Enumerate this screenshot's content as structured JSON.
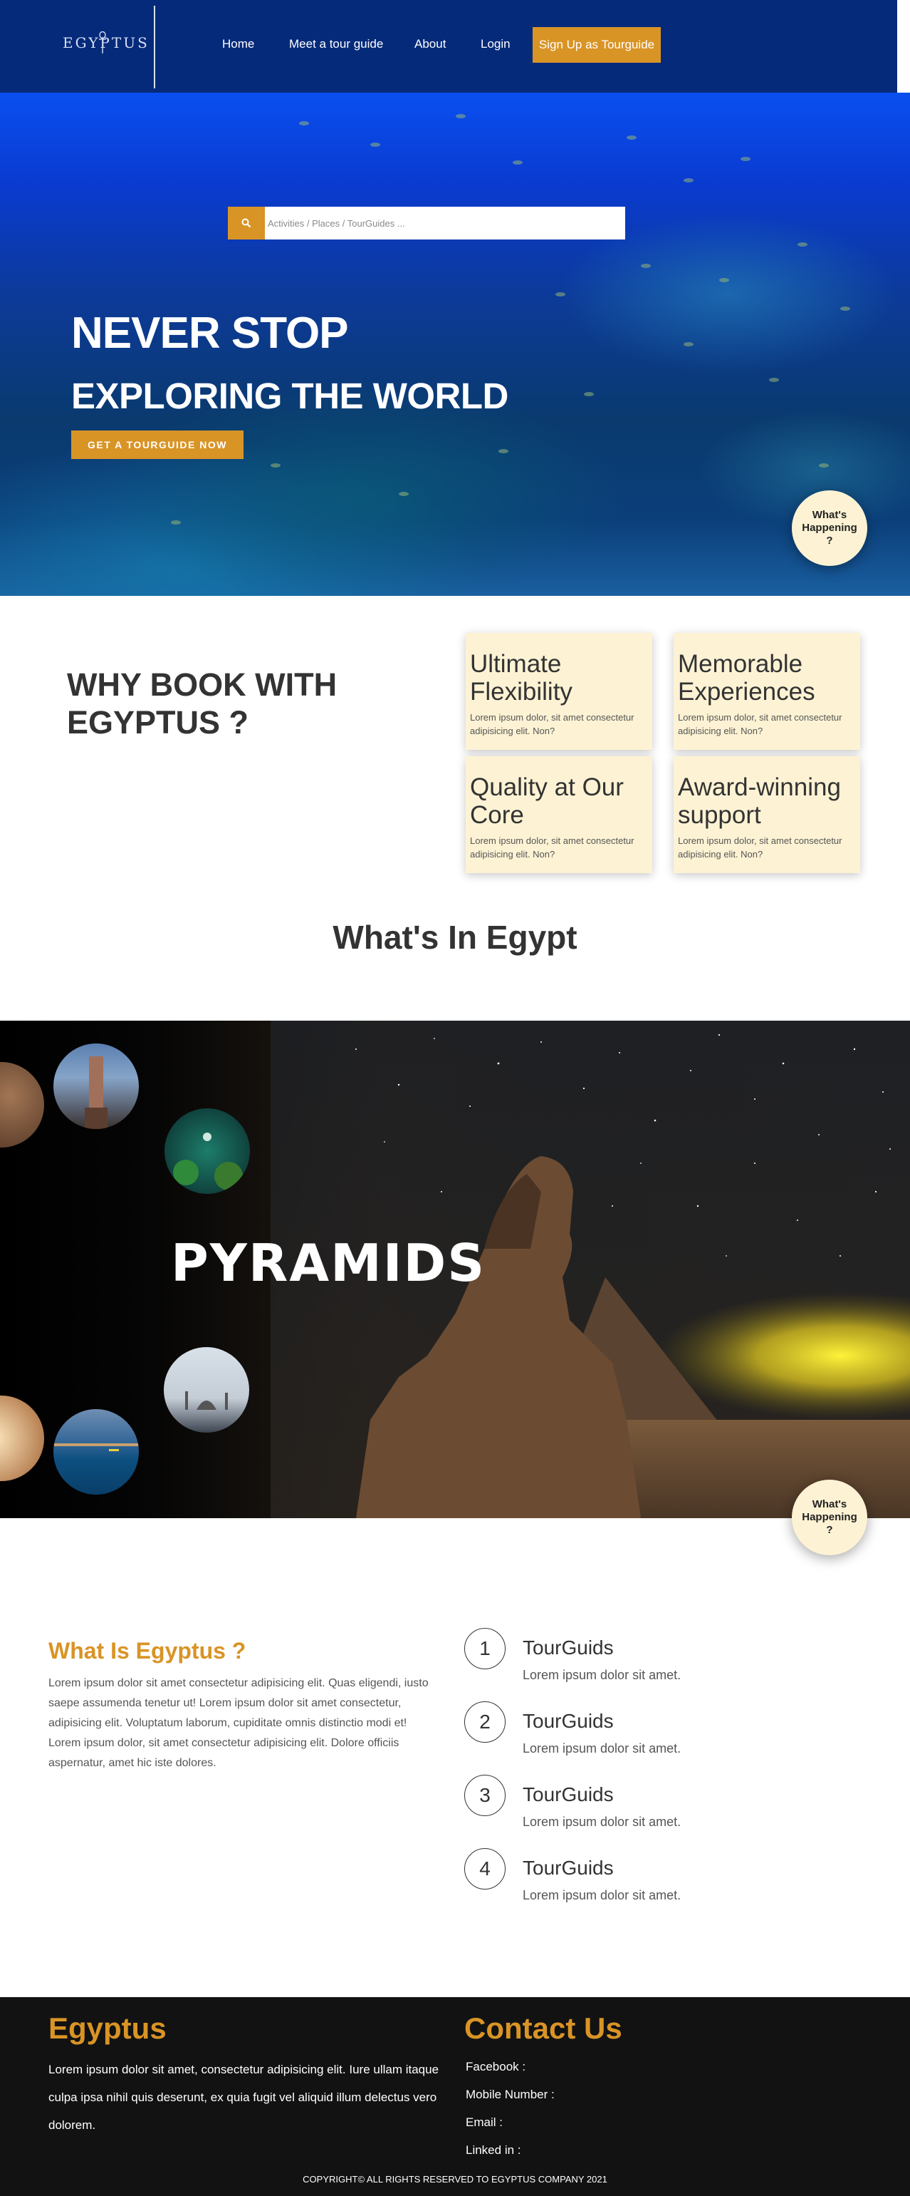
{
  "nav": {
    "logo_text": "EGYPTUS",
    "links": [
      "Home",
      "Meet a tour guide",
      "About",
      "Login"
    ],
    "cta": "Sign Up as Tourguide"
  },
  "hero": {
    "search_placeholder": "Activities / Places / TourGuides ...",
    "title_line1": "NEVER STOP",
    "title_line2": "EXPLORING THE WORLD",
    "cta": "GET A TOURGUIDE NOW"
  },
  "happening_button": "What's Happening ?",
  "why": {
    "title": "WHY BOOK WITH EGYPTUS ?",
    "features": [
      {
        "title": "Ultimate Flexibility",
        "text": "Lorem ipsum dolor, sit amet consectetur adipisicing elit. Non?"
      },
      {
        "title": "Memorable Experiences",
        "text": "Lorem ipsum dolor, sit amet consectetur adipisicing elit. Non?"
      },
      {
        "title": "Quality at Our Core",
        "text": "Lorem ipsum dolor, sit amet consectetur adipisicing elit. Non?"
      },
      {
        "title": "Award-winning support",
        "text": "Lorem ipsum dolor, sit amet consectetur adipisicing elit. Non?"
      }
    ]
  },
  "whats_in_egypt": {
    "title": "What's In Egypt",
    "slide_title": "PYRAMIDS"
  },
  "about": {
    "title": "What Is Egyptus ?",
    "text": "Lorem ipsum dolor sit amet consectetur adipisicing elit. Quas eligendi, iusto saepe assumenda tenetur ut! Lorem ipsum dolor sit amet consectetur, adipisicing elit. Voluptatum laborum, cupiditate omnis distinctio modi et! Lorem ipsum dolor, sit amet consectetur adipisicing elit. Dolore officiis aspernatur, amet hic iste dolores.",
    "steps": [
      {
        "num": "1",
        "title": "TourGuids",
        "text": "Lorem ipsum dolor sit amet."
      },
      {
        "num": "2",
        "title": "TourGuids",
        "text": "Lorem ipsum dolor sit amet."
      },
      {
        "num": "3",
        "title": "TourGuids",
        "text": "Lorem ipsum dolor sit amet."
      },
      {
        "num": "4",
        "title": "TourGuids",
        "text": "Lorem ipsum dolor sit amet."
      }
    ]
  },
  "footer": {
    "brand": "Egyptus",
    "text": "Lorem ipsum dolor sit amet, consectetur adipisicing elit. Iure ullam itaque culpa ipsa nihil quis deserunt, ex quia fugit vel aliquid illum delectus vero dolorem.",
    "contact_title": "Contact Us",
    "contact_lines": [
      "Facebook :",
      "Mobile Number :",
      "Email :",
      "Linked in :"
    ],
    "copyright": "COPYRIGHT© ALL RIGHTS RESERVED TO EGYPTUS COMPANY 2021"
  },
  "colors": {
    "nav_bg": "#062a7a",
    "accent": "#d99426",
    "card_bg": "#fdf3d4",
    "footer_bg": "#121212"
  }
}
